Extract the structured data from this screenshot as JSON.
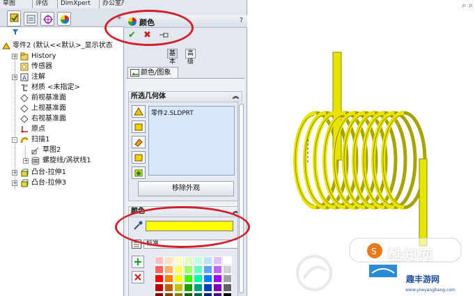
{
  "top_tabs": [
    "草图",
    "评估",
    "DimXpert",
    "办公室产品"
  ],
  "feature_tree": {
    "root_label": "零件2 (默认<<默认>_显示状态",
    "items": [
      {
        "label": "History",
        "icon": "history-folder-icon",
        "expand": "+"
      },
      {
        "label": "传感器",
        "icon": "sensor-icon",
        "expand": ""
      },
      {
        "label": "注解",
        "icon": "annotation-icon",
        "expand": "+"
      },
      {
        "label": "材质 <未指定>",
        "icon": "material-icon",
        "expand": ""
      },
      {
        "label": "前视基准面",
        "icon": "plane-icon",
        "expand": ""
      },
      {
        "label": "上视基准面",
        "icon": "plane-icon",
        "expand": ""
      },
      {
        "label": "右视基准面",
        "icon": "plane-icon",
        "expand": ""
      },
      {
        "label": "原点",
        "icon": "origin-icon",
        "expand": ""
      },
      {
        "label": "扫描1",
        "icon": "sweep-icon",
        "expand": "-"
      },
      {
        "label": "草图2",
        "icon": "sketch-icon",
        "expand": ""
      },
      {
        "label": "螺旋线/涡状线1",
        "icon": "helix-icon",
        "expand": "+"
      },
      {
        "label": "凸台-拉伸1",
        "icon": "extrude-icon",
        "expand": "+"
      },
      {
        "label": "凸台-拉伸3",
        "icon": "extrude-icon",
        "expand": "+"
      }
    ]
  },
  "property_manager": {
    "title": "颜色",
    "help": "?",
    "ok_icon": "checkmark-icon",
    "cancel_icon": "x-icon",
    "pin_icon": "pushpin-icon",
    "mode_basic": "基本",
    "mode_advanced": "高级",
    "tab_label": "颜色/图象",
    "selected_geometry": {
      "header": "所选几何体",
      "entries": [
        "零件2.SLDPRT"
      ],
      "remove_button": "移除外观"
    },
    "color": {
      "header": "颜色",
      "current_color": "#FFFF00",
      "standard_label": "标准"
    }
  },
  "viewport": {
    "part_color": "#E8E400",
    "watermark_cn": "酷知网",
    "watermark_site": "趣丰游网",
    "watermark_url": "www.yneyangbang.com"
  },
  "annotation_color": "#D31F2B"
}
